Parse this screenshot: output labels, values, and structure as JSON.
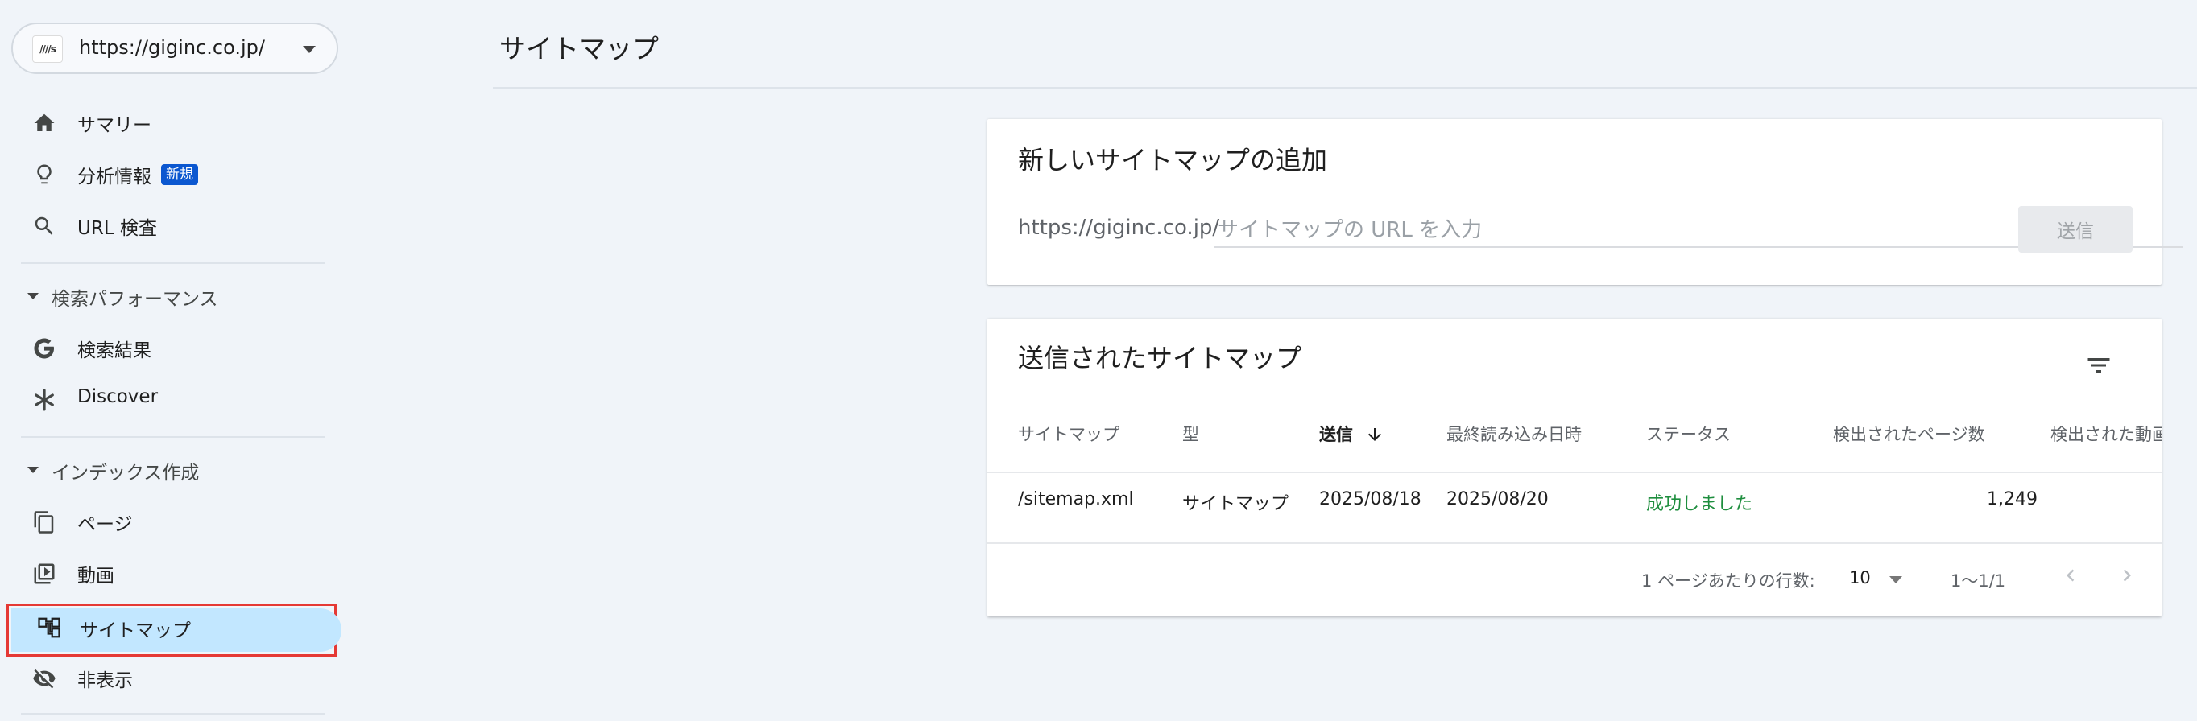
{
  "property": {
    "logo_text": "////s",
    "url": "https://giginc.co.jp/"
  },
  "sidebar": {
    "summary": "サマリー",
    "insights": "分析情報",
    "insights_badge": "新規",
    "url_inspect": "URL 検査",
    "section_search": "検索パフォーマンス",
    "search_results": "検索結果",
    "discover": "Discover",
    "section_index": "インデックス作成",
    "pages": "ページ",
    "videos": "動画",
    "sitemaps": "サイトマップ",
    "removals": "非表示"
  },
  "page": {
    "title": "サイトマップ"
  },
  "add_card": {
    "title": "新しいサイトマップの追加",
    "prefix": "https://giginc.co.jp/",
    "placeholder": "サイトマップの URL を入力",
    "submit": "送信"
  },
  "list_card": {
    "title": "送信されたサイトマップ",
    "columns": {
      "sitemap": "サイトマップ",
      "type": "型",
      "submitted": "送信",
      "last_read": "最終読み込み日時",
      "status": "ステータス",
      "pages_found": "検出されたページ数",
      "videos_found": "検出された動画"
    },
    "rows": [
      {
        "sitemap": "/sitemap.xml",
        "type": "サイトマップ",
        "submitted": "2025/08/18",
        "last_read": "2025/08/20",
        "status": "成功しました",
        "pages_found": "1,249"
      }
    ],
    "footer": {
      "rows_per_page_label": "1 ページあたりの行数:",
      "rows_per_page": "10",
      "range": "1〜1/1"
    }
  },
  "colors": {
    "accent": "#0b57d0",
    "active_nav": "#c2e7ff",
    "highlight_border": "#e53935",
    "success": "#1e8e3e"
  }
}
